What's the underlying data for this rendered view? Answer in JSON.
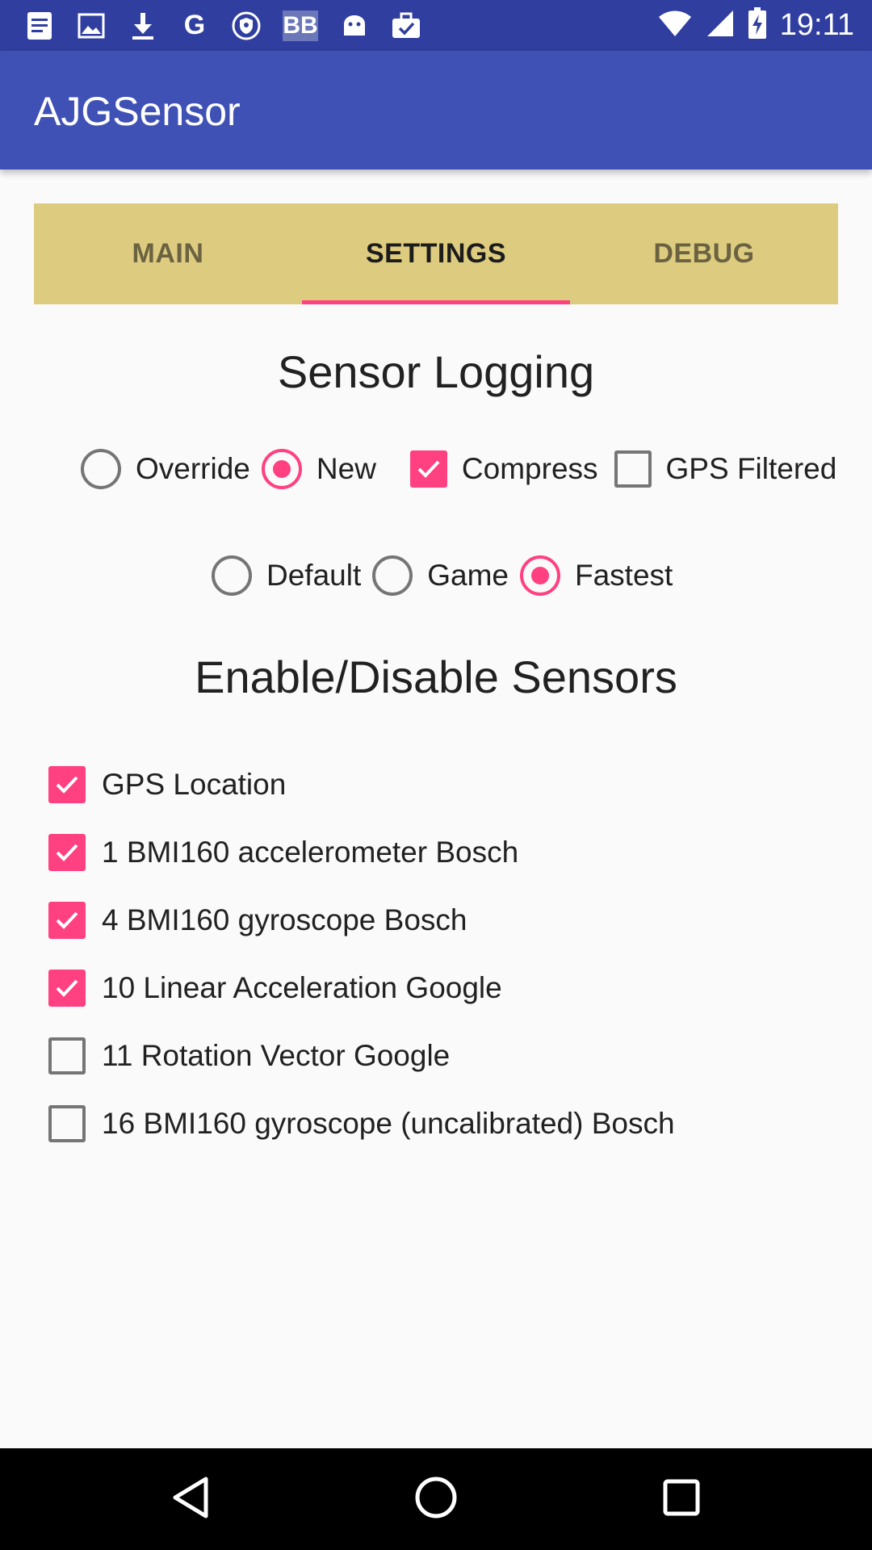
{
  "status_bar": {
    "icons": [
      "document-icon",
      "image-icon",
      "download-icon",
      "google-icon",
      "shield-icon",
      "bb-icon",
      "android-icon",
      "briefcase-check-icon"
    ],
    "google_glyph": "G",
    "bb_glyph": "BB",
    "time": "19:11"
  },
  "app_bar": {
    "title": "AJGSensor"
  },
  "tabs": [
    {
      "label": "MAIN",
      "active": false
    },
    {
      "label": "SETTINGS",
      "active": true
    },
    {
      "label": "DEBUG",
      "active": false
    }
  ],
  "sensor_logging": {
    "heading": "Sensor Logging",
    "mode_options": [
      {
        "label": "Override",
        "type": "radio",
        "checked": false
      },
      {
        "label": "New",
        "type": "radio",
        "checked": true
      },
      {
        "label": "Compress",
        "type": "checkbox",
        "checked": true
      },
      {
        "label": "GPS Filtered",
        "type": "checkbox",
        "checked": false
      }
    ],
    "rate_options": [
      {
        "label": "Default",
        "checked": false
      },
      {
        "label": "Game",
        "checked": false
      },
      {
        "label": "Fastest",
        "checked": true
      }
    ]
  },
  "sensors": {
    "heading": "Enable/Disable Sensors",
    "items": [
      {
        "label": "GPS Location",
        "checked": true
      },
      {
        "label": "1 BMI160 accelerometer Bosch",
        "checked": true
      },
      {
        "label": "4 BMI160 gyroscope Bosch",
        "checked": true
      },
      {
        "label": "10 Linear Acceleration Google",
        "checked": true
      },
      {
        "label": "11 Rotation Vector Google",
        "checked": false
      },
      {
        "label": "16 BMI160 gyroscope (uncalibrated) Bosch",
        "checked": false
      }
    ]
  },
  "nav_bar": {
    "buttons": [
      "back-icon",
      "home-icon",
      "recents-icon"
    ]
  },
  "colors": {
    "primary": "#3f51b5",
    "primary_dark": "#303f9f",
    "accent": "#ff4081",
    "tab_background": "#ddcc80"
  }
}
